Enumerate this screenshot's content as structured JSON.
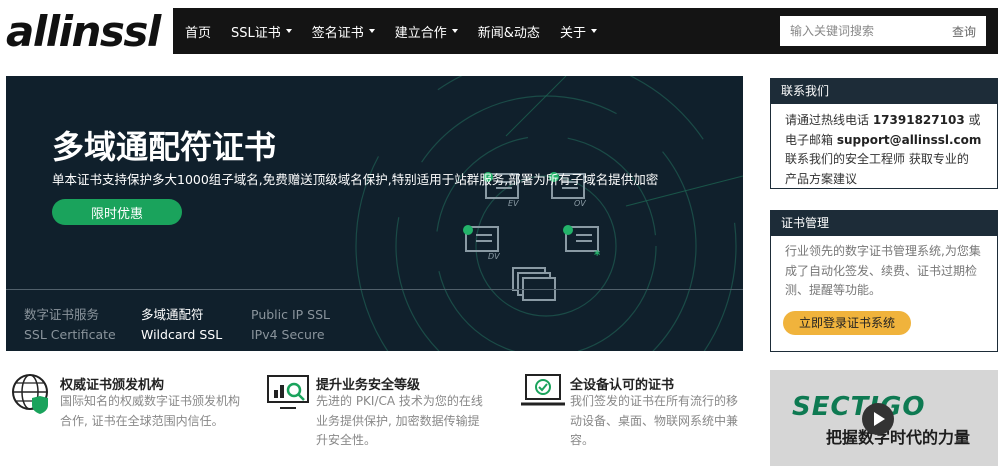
{
  "header": {
    "logo": "allinssl",
    "nav": [
      {
        "label": "首页",
        "has_dropdown": false
      },
      {
        "label": "SSL证书",
        "has_dropdown": true
      },
      {
        "label": "签名证书",
        "has_dropdown": true
      },
      {
        "label": "建立合作",
        "has_dropdown": true
      },
      {
        "label": "新闻&动态",
        "has_dropdown": false
      },
      {
        "label": "关于",
        "has_dropdown": true
      }
    ],
    "search": {
      "placeholder": "输入关键词搜索",
      "button": "查询"
    }
  },
  "hero": {
    "title": "多域通配符证书",
    "subtitle": "单本证书支持保护多大1000组子域名,免费赠送顶级域名保护,特别适用于站群服务,部署为所有子域名提供加密",
    "button": "限时优惠",
    "badges": [
      "EV",
      "OV",
      "DV"
    ],
    "tabs": [
      {
        "line1": "数字证书服务",
        "line2": "SSL Certificate",
        "active": false
      },
      {
        "line1": "多域通配符",
        "line2": "Wildcard SSL",
        "active": true
      },
      {
        "line1": "Public IP SSL",
        "line2": "IPv4 Secure",
        "active": false
      }
    ]
  },
  "sidebar": {
    "contact": {
      "title": "联系我们",
      "line1_prefix": "请通过热线电话 ",
      "phone": "17391827103",
      "line1_suffix": " 或",
      "line2_prefix": "电子邮箱 ",
      "email": "support@allinssl.com",
      "line3": "联系我们的安全工程师 获取专业的",
      "line4": "产品方案建议"
    },
    "cert_mgmt": {
      "title": "证书管理",
      "desc": "行业领先的数字证书管理系统,为您集成了自动化签发、续费、证书过期检测、提醒等功能。",
      "button": "立即登录证书系统"
    },
    "video": {
      "brand": "SECTIGO",
      "caption": "把握数字时代的力量"
    }
  },
  "features": [
    {
      "title": "权威证书颁发机构",
      "desc": "国际知名的权威数字证书颁发机构合作, 证书在全球范围内信任。"
    },
    {
      "title": "提升业务安全等级",
      "desc": "先进的 PKI/CA 技术为您的在线业务提供保护, 加密数据传输提升安全性。"
    },
    {
      "title": "全设备认可的证书",
      "desc": "我们签发的证书在所有流行的移动设备、桌面、物联网系统中兼容。"
    }
  ],
  "colors": {
    "navbar": "#141414",
    "hero_bg": "#10202c",
    "accent_green": "#1aa35c",
    "card_head": "#1d2c38",
    "button_yellow": "#f0b33c"
  }
}
